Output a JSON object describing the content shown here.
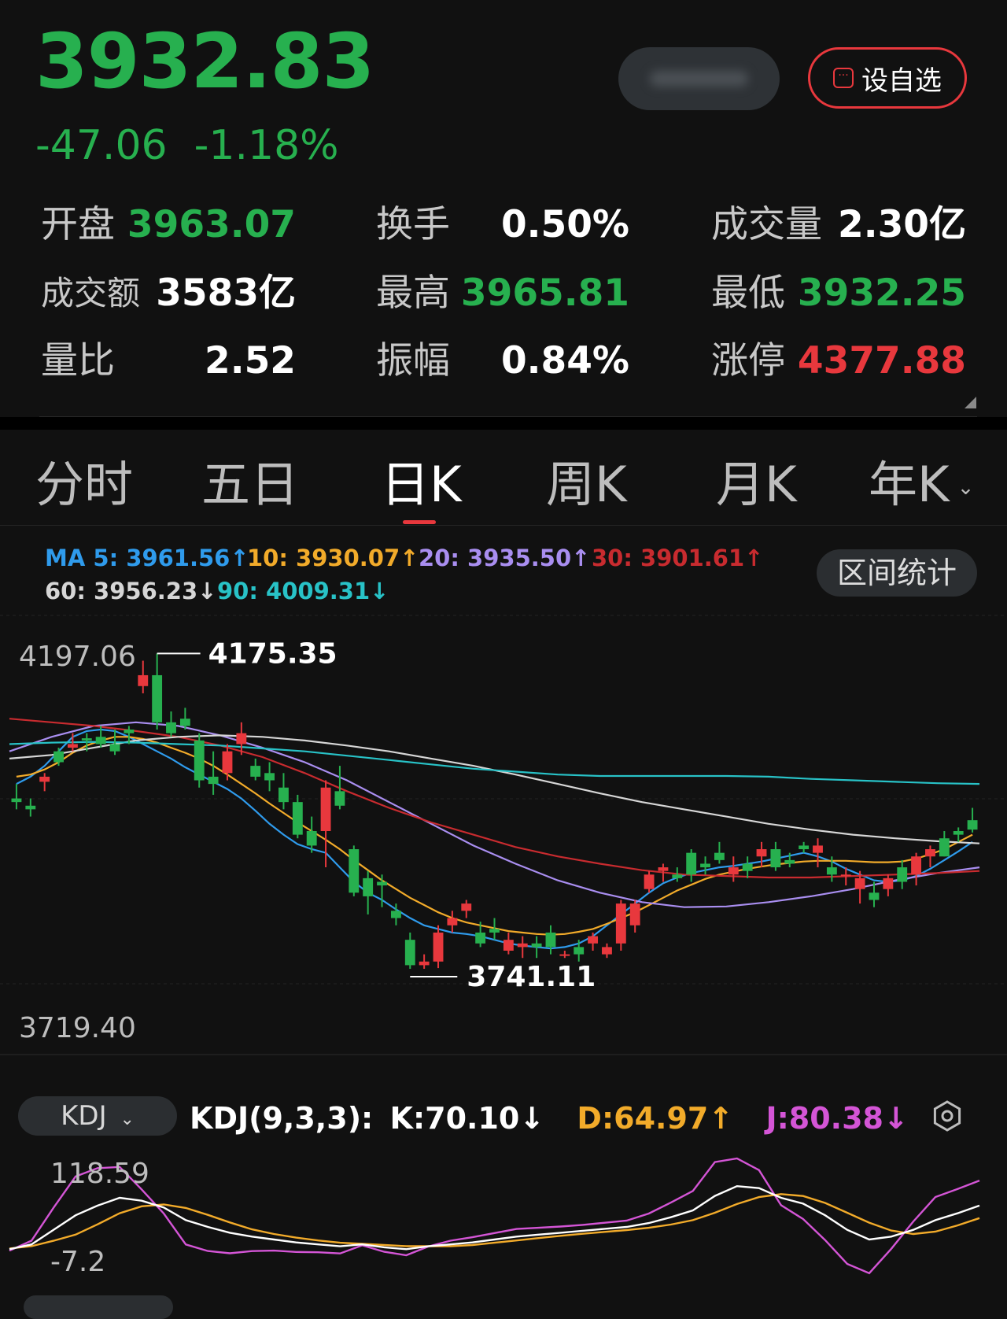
{
  "header": {
    "price": "3932.83",
    "change": "-47.06",
    "change_pct": "-1.18%",
    "watch_button": "设自选"
  },
  "stats": [
    {
      "label": "开盘",
      "value": "3963.07",
      "color": "green"
    },
    {
      "label": "换手",
      "value": "0.50%",
      "color": "white"
    },
    {
      "label": "成交量",
      "value": "2.30亿",
      "color": "white"
    },
    {
      "label": "成交额",
      "value": "3583亿",
      "color": "white"
    },
    {
      "label": "最高",
      "value": "3965.81",
      "color": "green"
    },
    {
      "label": "最低",
      "value": "3932.25",
      "color": "green"
    },
    {
      "label": "量比",
      "value": "2.52",
      "color": "white"
    },
    {
      "label": "振幅",
      "value": "0.84%",
      "color": "white"
    },
    {
      "label": "涨停",
      "value": "4377.88",
      "color": "red"
    }
  ],
  "tabs": [
    {
      "label": "分时",
      "active": false
    },
    {
      "label": "五日",
      "active": false
    },
    {
      "label": "日K",
      "active": true
    },
    {
      "label": "周K",
      "active": false
    },
    {
      "label": "月K",
      "active": false
    },
    {
      "label": "年K",
      "active": false
    }
  ],
  "ma_legend": {
    "ma5": "MA 5: 3961.56↑",
    "ma10": "10: 3930.07↑",
    "ma20": "20: 3935.50↑",
    "ma30": "30: 3901.61↑",
    "ma60": "60: 3956.23↓",
    "ma90": "90: 4009.31↓"
  },
  "range_button": "区间统计",
  "kdj": {
    "selector": "KDJ",
    "title": "KDJ(9,3,3):",
    "k": "K:70.10↓",
    "d": "D:64.97↑",
    "j": "J:80.38↓",
    "y_max": "118.59",
    "y_min": "-7.2"
  },
  "colors": {
    "up": "#e8383d",
    "down": "#27b04f",
    "ma5": "#2f9bec",
    "ma10": "#f2ab2a",
    "ma20": "#a98ef0",
    "ma30": "#c82b2f",
    "ma60": "#d6d6d6",
    "ma90": "#28c2c7",
    "kdj_k": "#ffffff",
    "kdj_d": "#f2ab2a",
    "kdj_j": "#d455d6"
  },
  "chart_data": {
    "type": "candlestick",
    "y_axis_max_label": "4197.06",
    "y_axis_min_label": "3719.40",
    "ylim": [
      3719.4,
      4197.06
    ],
    "high_marker": "4175.35",
    "low_marker": "3741.11",
    "candles": [
      [
        3975,
        3995,
        3960,
        3970
      ],
      [
        3965,
        3975,
        3950,
        3960
      ],
      [
        3998,
        4010,
        3985,
        4005
      ],
      [
        4040,
        4045,
        4020,
        4025
      ],
      [
        4045,
        4065,
        4040,
        4050
      ],
      [
        4058,
        4065,
        4040,
        4055
      ],
      [
        4060,
        4075,
        4045,
        4050
      ],
      [
        4050,
        4070,
        4035,
        4040
      ],
      [
        4070,
        4075,
        4050,
        4065
      ],
      [
        4130,
        4165,
        4120,
        4145
      ],
      [
        4145,
        4175,
        4070,
        4080
      ],
      [
        4080,
        4095,
        4060,
        4065
      ],
      [
        4085,
        4100,
        4070,
        4075
      ],
      [
        4055,
        4065,
        3990,
        4000
      ],
      [
        4005,
        4040,
        3980,
        3995
      ],
      [
        4010,
        4050,
        4000,
        4040
      ],
      [
        4050,
        4080,
        4035,
        4065
      ],
      [
        4020,
        4030,
        4000,
        4005
      ],
      [
        4010,
        4025,
        3985,
        4000
      ],
      [
        3990,
        4010,
        3960,
        3970
      ],
      [
        3970,
        3980,
        3920,
        3925
      ],
      [
        3930,
        3950,
        3900,
        3910
      ],
      [
        3930,
        4000,
        3880,
        3990
      ],
      [
        3985,
        4020,
        3960,
        3965
      ],
      [
        3905,
        3910,
        3840,
        3845
      ],
      [
        3865,
        3875,
        3815,
        3840
      ],
      [
        3860,
        3870,
        3825,
        3855
      ],
      [
        3820,
        3830,
        3800,
        3810
      ],
      [
        3780,
        3790,
        3740,
        3745
      ],
      [
        3745,
        3760,
        3740,
        3750
      ],
      [
        3750,
        3800,
        3741,
        3790
      ],
      [
        3800,
        3820,
        3790,
        3810
      ],
      [
        3820,
        3835,
        3810,
        3830
      ],
      [
        3790,
        3805,
        3770,
        3775
      ],
      [
        3795,
        3810,
        3780,
        3790
      ],
      [
        3765,
        3790,
        3760,
        3780
      ],
      [
        3770,
        3785,
        3755,
        3775
      ],
      [
        3775,
        3785,
        3755,
        3770
      ],
      [
        3790,
        3800,
        3760,
        3770
      ],
      [
        3760,
        3765,
        3755,
        3760
      ],
      [
        3770,
        3780,
        3750,
        3760
      ],
      [
        3775,
        3790,
        3765,
        3785
      ],
      [
        3760,
        3775,
        3755,
        3770
      ],
      [
        3775,
        3835,
        3765,
        3830
      ],
      [
        3800,
        3835,
        3790,
        3830
      ],
      [
        3850,
        3875,
        3845,
        3870
      ],
      [
        3875,
        3885,
        3860,
        3880
      ],
      [
        3870,
        3880,
        3860,
        3865
      ],
      [
        3900,
        3905,
        3860,
        3870
      ],
      [
        3885,
        3895,
        3870,
        3880
      ],
      [
        3900,
        3915,
        3885,
        3890
      ],
      [
        3870,
        3895,
        3860,
        3880
      ],
      [
        3885,
        3895,
        3865,
        3875
      ],
      [
        3895,
        3915,
        3880,
        3905
      ],
      [
        3905,
        3915,
        3875,
        3880
      ],
      [
        3890,
        3900,
        3880,
        3885
      ],
      [
        3910,
        3915,
        3900,
        3905
      ],
      [
        3900,
        3920,
        3880,
        3910
      ],
      [
        3880,
        3895,
        3860,
        3870
      ],
      [
        3870,
        3880,
        3855,
        3870
      ],
      [
        3850,
        3875,
        3830,
        3865
      ],
      [
        3845,
        3860,
        3825,
        3835
      ],
      [
        3850,
        3870,
        3840,
        3865
      ],
      [
        3880,
        3890,
        3850,
        3860
      ],
      [
        3870,
        3900,
        3855,
        3895
      ],
      [
        3895,
        3910,
        3880,
        3905
      ],
      [
        3920,
        3930,
        3895,
        3895
      ],
      [
        3930,
        3935,
        3915,
        3925
      ],
      [
        3945,
        3962,
        3928,
        3932
      ]
    ],
    "ma_series": [
      {
        "name": "MA 5",
        "values": [
          3995,
          4005,
          4020,
          4040,
          4060,
          4068,
          4070,
          4068,
          4060,
          4050,
          4040,
          4030,
          4018,
          4008,
          3998,
          3988,
          3975,
          3958,
          3940,
          3925,
          3912,
          3905,
          3900,
          3880,
          3860,
          3845,
          3835,
          3822,
          3810,
          3800,
          3795,
          3790,
          3788,
          3785,
          3780,
          3775,
          3772,
          3770,
          3768,
          3770,
          3775,
          3785,
          3800,
          3815,
          3830,
          3845,
          3858,
          3866,
          3872,
          3876,
          3880,
          3882,
          3885,
          3888,
          3892,
          3896,
          3900,
          3895,
          3888,
          3878,
          3870,
          3862,
          3860,
          3862,
          3868,
          3878,
          3890,
          3902,
          3915
        ]
      },
      {
        "name": "10",
        "values": [
          4005,
          4008,
          4015,
          4025,
          4038,
          4048,
          4055,
          4060,
          4060,
          4057,
          4052,
          4045,
          4038,
          4030,
          4020,
          4008,
          3995,
          3982,
          3968,
          3955,
          3942,
          3930,
          3918,
          3905,
          3890,
          3876,
          3862,
          3850,
          3838,
          3828,
          3818,
          3810,
          3804,
          3800,
          3796,
          3792,
          3790,
          3788,
          3787,
          3788,
          3791,
          3795,
          3802,
          3810,
          3818,
          3828,
          3838,
          3848,
          3856,
          3864,
          3870,
          3874,
          3878,
          3881,
          3884,
          3886,
          3888,
          3889,
          3889,
          3889,
          3888,
          3887,
          3887,
          3888,
          3892,
          3898,
          3905,
          3915,
          3925
        ]
      }
    ],
    "kdj_values": {
      "k": [
        25,
        30,
        45,
        60,
        70,
        78,
        75,
        68,
        55,
        48,
        42,
        38,
        35,
        32,
        30,
        28,
        30,
        27,
        25,
        28,
        30,
        32,
        35,
        38,
        40,
        42,
        44,
        46,
        48,
        52,
        58,
        65,
        80,
        90,
        88,
        78,
        72,
        60,
        45,
        35,
        38,
        45,
        55,
        62,
        70
      ]
    }
  }
}
